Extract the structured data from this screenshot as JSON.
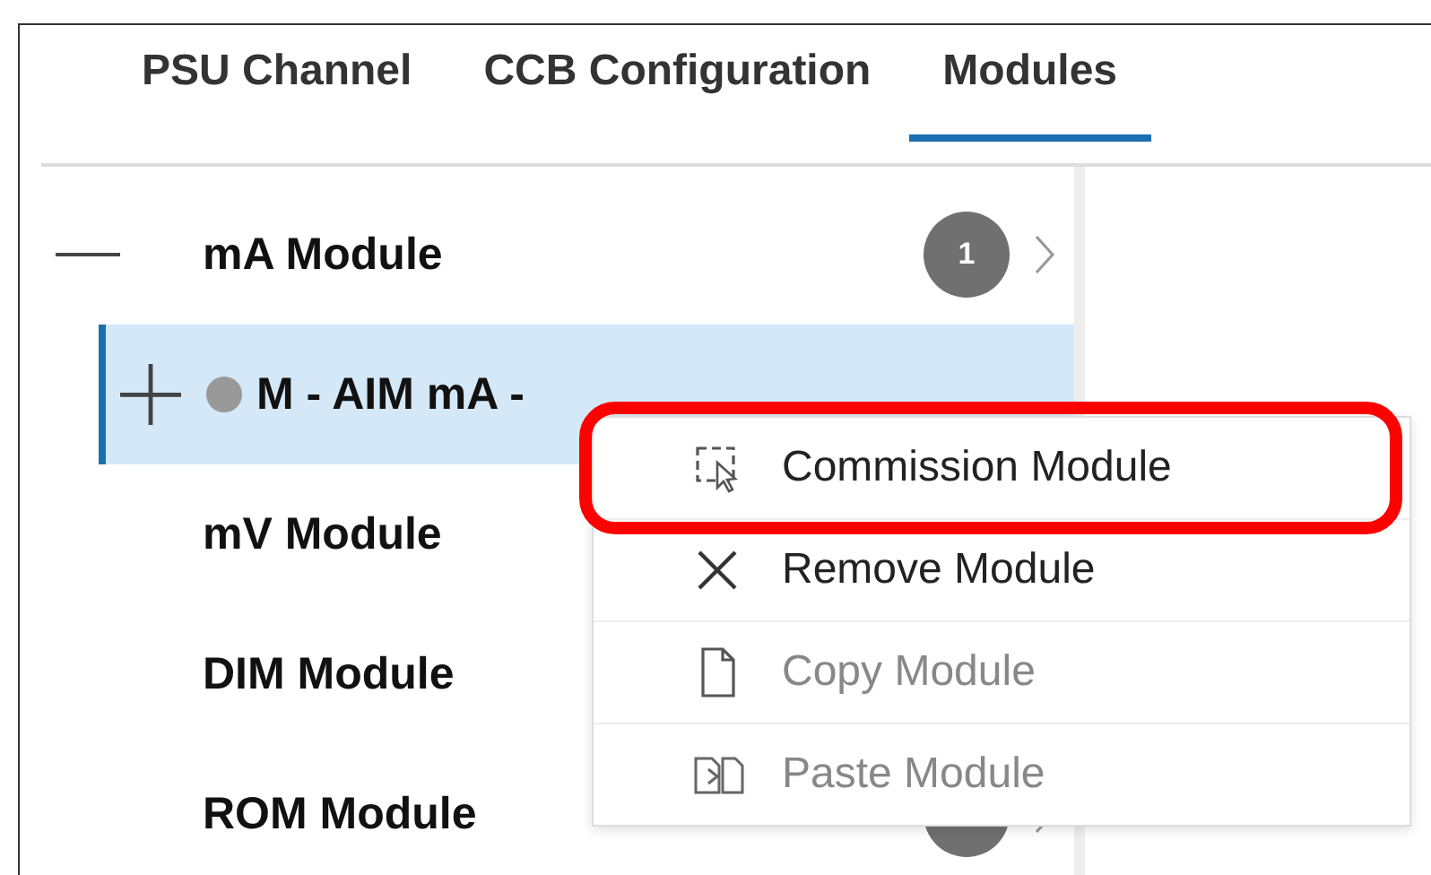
{
  "tabs": [
    {
      "label": "PSU Channel",
      "selected": false
    },
    {
      "label": "CCB Configuration",
      "selected": false
    },
    {
      "label": "Modules",
      "selected": true
    }
  ],
  "tree": {
    "items": [
      {
        "label": "mA Module",
        "expanded": true,
        "badge": true,
        "count": "1",
        "chevron": true,
        "children": [
          {
            "label": "M - AIM mA -",
            "expanded": false,
            "status_dot": true,
            "selected": true
          }
        ]
      },
      {
        "label": "mV Module"
      },
      {
        "label": "DIM Module"
      },
      {
        "label": "ROM Module",
        "badge": true,
        "chevron": true
      }
    ]
  },
  "context_menu": {
    "items": [
      {
        "label": "Commission Module",
        "kind": "commission",
        "disabled": false,
        "highlighted": true
      },
      {
        "label": "Remove Module",
        "kind": "remove",
        "disabled": false,
        "highlighted": false
      },
      {
        "label": "Copy Module",
        "kind": "copy",
        "disabled": true,
        "highlighted": false
      },
      {
        "label": "Paste Module",
        "kind": "paste",
        "disabled": true,
        "highlighted": false
      }
    ]
  }
}
